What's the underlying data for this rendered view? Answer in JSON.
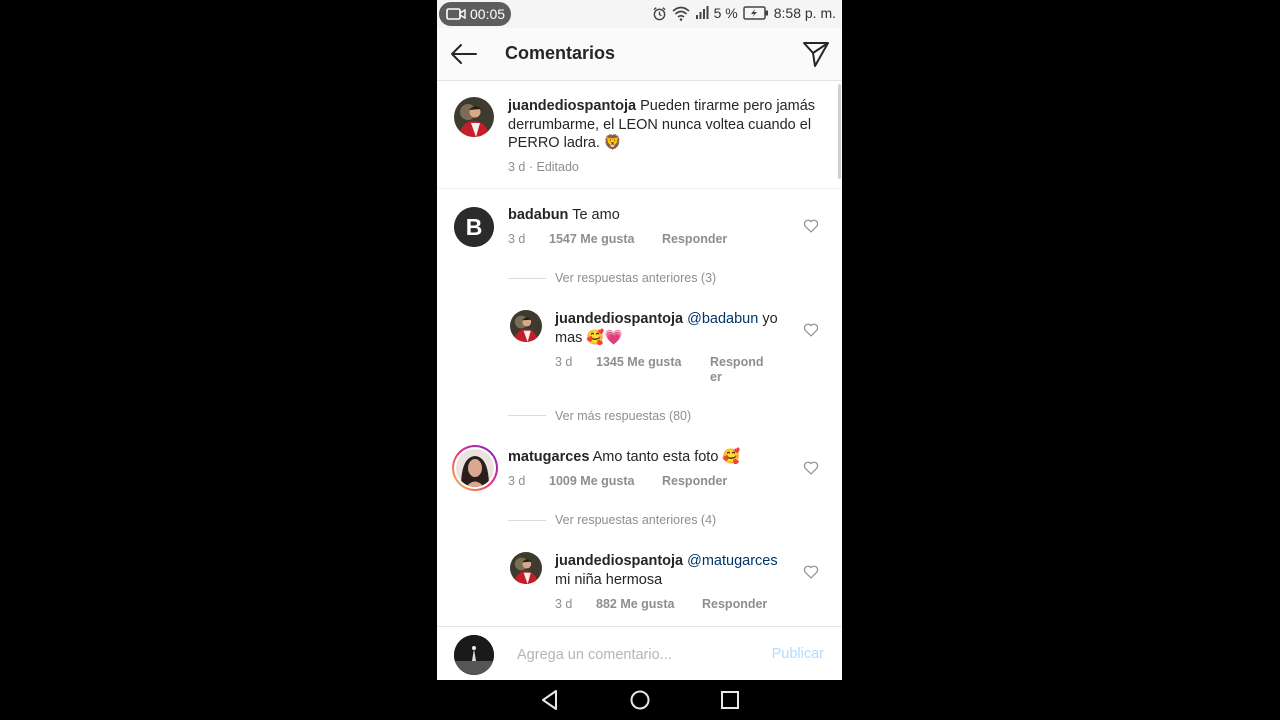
{
  "status_bar": {
    "recording_time": "00:05",
    "battery": "5 %",
    "clock": "8:58 p. m."
  },
  "header": {
    "title": "Comentarios"
  },
  "caption": {
    "username": "juandediospantoja",
    "text": "Pueden tirarme pero jamás derrumbarme, el LEON nunca voltea cuando el PERRO ladra. 🦁",
    "meta": "3 d · Editado"
  },
  "comments": [
    {
      "username": "badabun",
      "text": "Te amo",
      "age": "3 d",
      "likes": "1547 Me gusta",
      "reply_label": "Responder",
      "view_previous": "Ver respuestas anteriores (3)",
      "reply": {
        "username": "juandediospantoja",
        "mention": "@badabun",
        "text": "yo mas 🥰💗",
        "age": "3 d",
        "likes": "1345 Me gusta",
        "reply_label": "Respond er"
      },
      "view_more": "Ver más respuestas (80)"
    },
    {
      "username": "matugarces",
      "text": "Amo tanto esta foto 🥰",
      "age": "3 d",
      "likes": "1009 Me gusta",
      "reply_label": "Responder",
      "view_previous": "Ver respuestas anteriores (4)",
      "reply": {
        "username": "juandediospantoja",
        "mention": "@matugarces",
        "text": "mi niña hermosa",
        "age": "3 d",
        "likes": "882 Me gusta",
        "reply_label": "Responder"
      }
    }
  ],
  "composer": {
    "placeholder": "Agrega un comentario...",
    "publish_label": "Publicar"
  },
  "colors": {
    "link_blue": "#003569",
    "publish_disabled": "#b3dbff",
    "meta_gray": "#8e8e8e",
    "story_ring": "#d6249f"
  },
  "icons": [
    "video-camera-icon",
    "alarm-icon",
    "wifi-icon",
    "signal-icon",
    "battery-icon",
    "back-arrow-icon",
    "direct-send-icon",
    "heart-icon",
    "nav-back-icon",
    "nav-home-icon",
    "nav-recents-icon"
  ]
}
